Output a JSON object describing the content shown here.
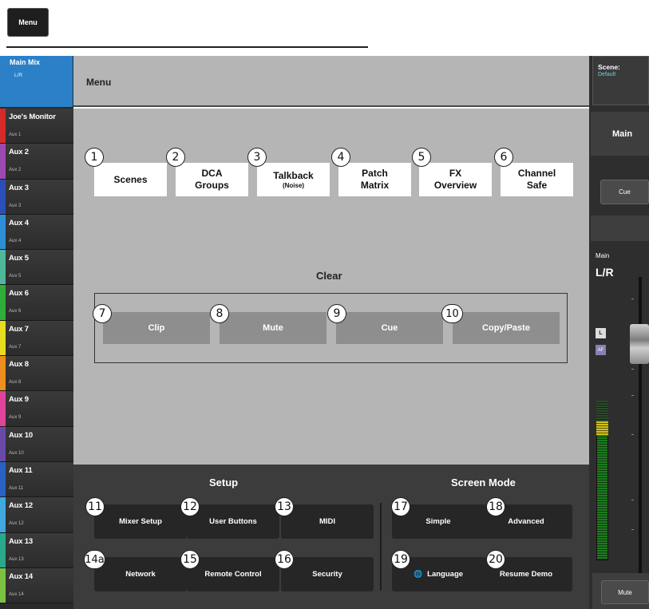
{
  "top": {
    "menu_label": "Menu"
  },
  "sidebar": {
    "main_mix": {
      "name": "Main Mix",
      "sub": "L/R",
      "color": "#2b80c8"
    },
    "aux": [
      {
        "name": "Joe's Monitor",
        "sub": "Aux 1",
        "color": "#d42a2a"
      },
      {
        "name": "Aux 2",
        "sub": "Aux 2",
        "color": "#9b4bb0"
      },
      {
        "name": "Aux 3",
        "sub": "Aux 3",
        "color": "#2b4fb8"
      },
      {
        "name": "Aux 4",
        "sub": "Aux 4",
        "color": "#2f8fd6"
      },
      {
        "name": "Aux 5",
        "sub": "Aux 5",
        "color": "#4fb89a"
      },
      {
        "name": "Aux 6",
        "sub": "Aux 6",
        "color": "#2fae3a"
      },
      {
        "name": "Aux 7",
        "sub": "Aux 7",
        "color": "#e9dc1f"
      },
      {
        "name": "Aux 8",
        "sub": "Aux 8",
        "color": "#ec8f1e"
      },
      {
        "name": "Aux 9",
        "sub": "Aux 9",
        "color": "#e0439a"
      },
      {
        "name": "Aux 10",
        "sub": "Aux 10",
        "color": "#6a4aa8"
      },
      {
        "name": "Aux 11",
        "sub": "Aux 11",
        "color": "#2a62c4"
      },
      {
        "name": "Aux 12",
        "sub": "Aux 12",
        "color": "#3fa9e0"
      },
      {
        "name": "Aux 13",
        "sub": "Aux 13",
        "color": "#2aa88a"
      },
      {
        "name": "Aux 14",
        "sub": "Aux 14",
        "color": "#7cc242"
      }
    ]
  },
  "header": {
    "title": "Menu"
  },
  "menu_tiles": [
    {
      "num": "1",
      "label": "Scenes",
      "sub": ""
    },
    {
      "num": "2",
      "label": "DCA Groups",
      "sub": ""
    },
    {
      "num": "3",
      "label": "Talkback",
      "sub": "(Noise)"
    },
    {
      "num": "4",
      "label": "Patch Matrix",
      "sub": ""
    },
    {
      "num": "5",
      "label": "FX Overview",
      "sub": ""
    },
    {
      "num": "6",
      "label": "Channel Safe",
      "sub": ""
    }
  ],
  "clear": {
    "title": "Clear",
    "buttons": [
      {
        "num": "7",
        "label": "Clip"
      },
      {
        "num": "8",
        "label": "Mute"
      },
      {
        "num": "9",
        "label": "Cue"
      },
      {
        "num": "10",
        "label": "Copy/Paste"
      }
    ]
  },
  "setup": {
    "title": "Setup",
    "buttons": [
      {
        "num": "11",
        "label": "Mixer Setup"
      },
      {
        "num": "12",
        "label": "User Buttons"
      },
      {
        "num": "13",
        "label": "MIDI"
      },
      {
        "num": "14a",
        "label": "Network"
      },
      {
        "num": "15",
        "label": "Remote Control"
      },
      {
        "num": "16",
        "label": "Security"
      }
    ]
  },
  "screen_mode": {
    "title": "Screen Mode",
    "buttons": [
      {
        "num": "17",
        "label": "Simple"
      },
      {
        "num": "18",
        "label": "Advanced"
      },
      {
        "num": "19",
        "label": "Language",
        "icon": "language-icon"
      },
      {
        "num": "20",
        "label": "Resume Demo"
      }
    ]
  },
  "right_panel": {
    "scene_label": "Scene:",
    "scene_value": "Default",
    "main_tab": "Main",
    "cue_label": "Cue",
    "main_small": "Main",
    "lr_label": "L/R",
    "l_badge": "L",
    "af_badge": "AF",
    "mute_label": "Mute"
  }
}
